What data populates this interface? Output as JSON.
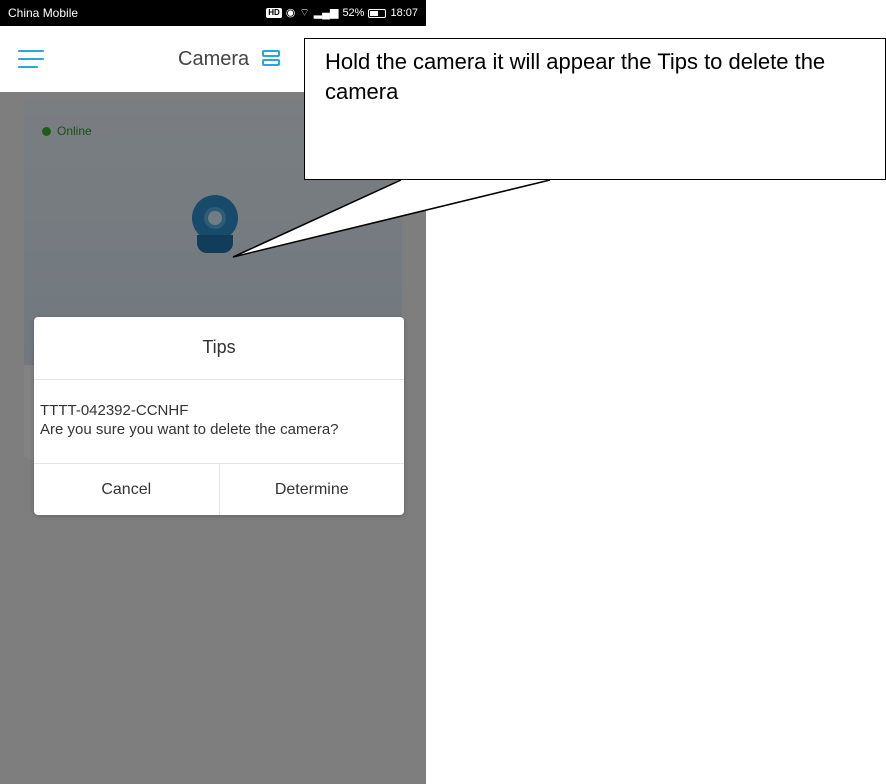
{
  "status_bar": {
    "carrier": "China Mobile",
    "hd_label": "HD",
    "battery_percent": "52%",
    "battery_level": 0.52,
    "time": "18:07"
  },
  "header": {
    "title": "Camera"
  },
  "camera_card": {
    "status": "Online"
  },
  "dialog": {
    "title": "Tips",
    "device_id": "TTTT-042392-CCNHF",
    "message": "Are you sure you want to delete the camera?",
    "cancel_label": "Cancel",
    "confirm_label": "Determine"
  },
  "annotation": {
    "text": "Hold the camera it will appear the Tips to delete the camera"
  },
  "colors": {
    "accent": "#29a7db",
    "online": "#37b531",
    "overlay": "rgba(0,0,0,0.48)"
  },
  "icons": {
    "menu": "menu-icon",
    "layout": "layout-icon",
    "camera": "camera-icon",
    "signal": "signal-icon",
    "wifi": "wifi-icon",
    "eye": "eye-icon",
    "battery": "battery-icon"
  }
}
